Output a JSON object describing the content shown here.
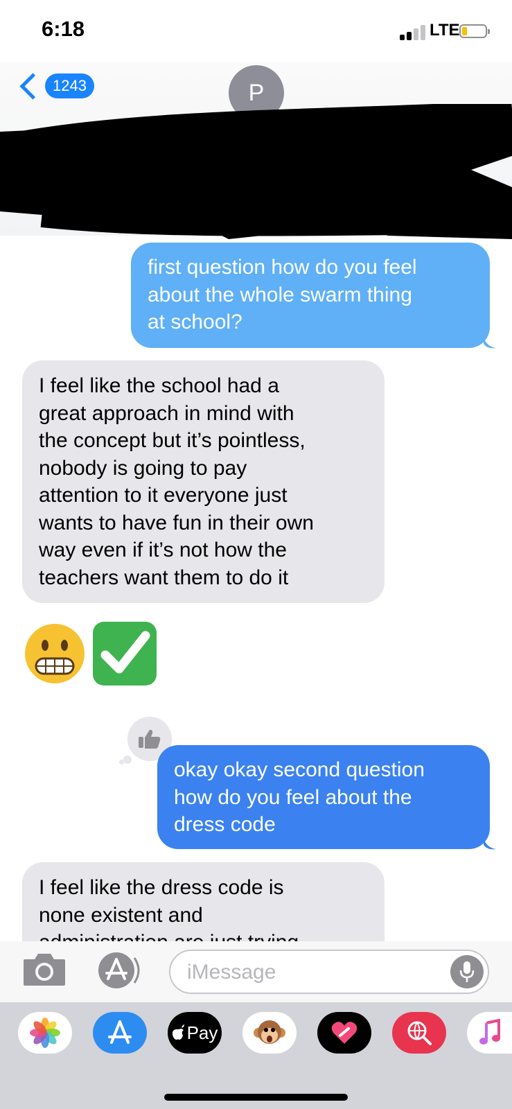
{
  "status_bar": {
    "time": "6:18",
    "network": "LTE"
  },
  "nav": {
    "back_count": "1243",
    "contact_initial": "P"
  },
  "messages": {
    "sent_1": [
      "first question how do you feel",
      "about the whole swarm thing",
      "at school?"
    ],
    "received_1": [
      "I feel like the school had a",
      "great approach in mind with",
      "the concept but it’s pointless,",
      "nobody is going to pay",
      "attention to it everyone just",
      "wants to have fun in their own",
      "way even if it’s not how the",
      "teachers want them to do it"
    ],
    "emoji_reply": "😬✅",
    "sent_2": [
      "okay okay second question",
      "how do you feel about the",
      "dress code"
    ],
    "received_2": [
      "I feel like the dress code is",
      "none existent and",
      "administration are just trying"
    ]
  },
  "composer": {
    "placeholder": "iMessage"
  },
  "app_drawer": {
    "apple_pay_label": "Pay"
  },
  "colors": {
    "sent_light": "#5fb0f6",
    "sent_dark": "#3b82f0",
    "received": "#e6e6eb",
    "accent": "#1a84ff"
  },
  "icons": [
    "camera-icon",
    "app-store-icon",
    "microphone-icon",
    "photos-icon",
    "apple-pay-icon",
    "animoji-icon",
    "heart-icon",
    "web-search-icon",
    "music-icon",
    "thumbs-up-icon"
  ]
}
